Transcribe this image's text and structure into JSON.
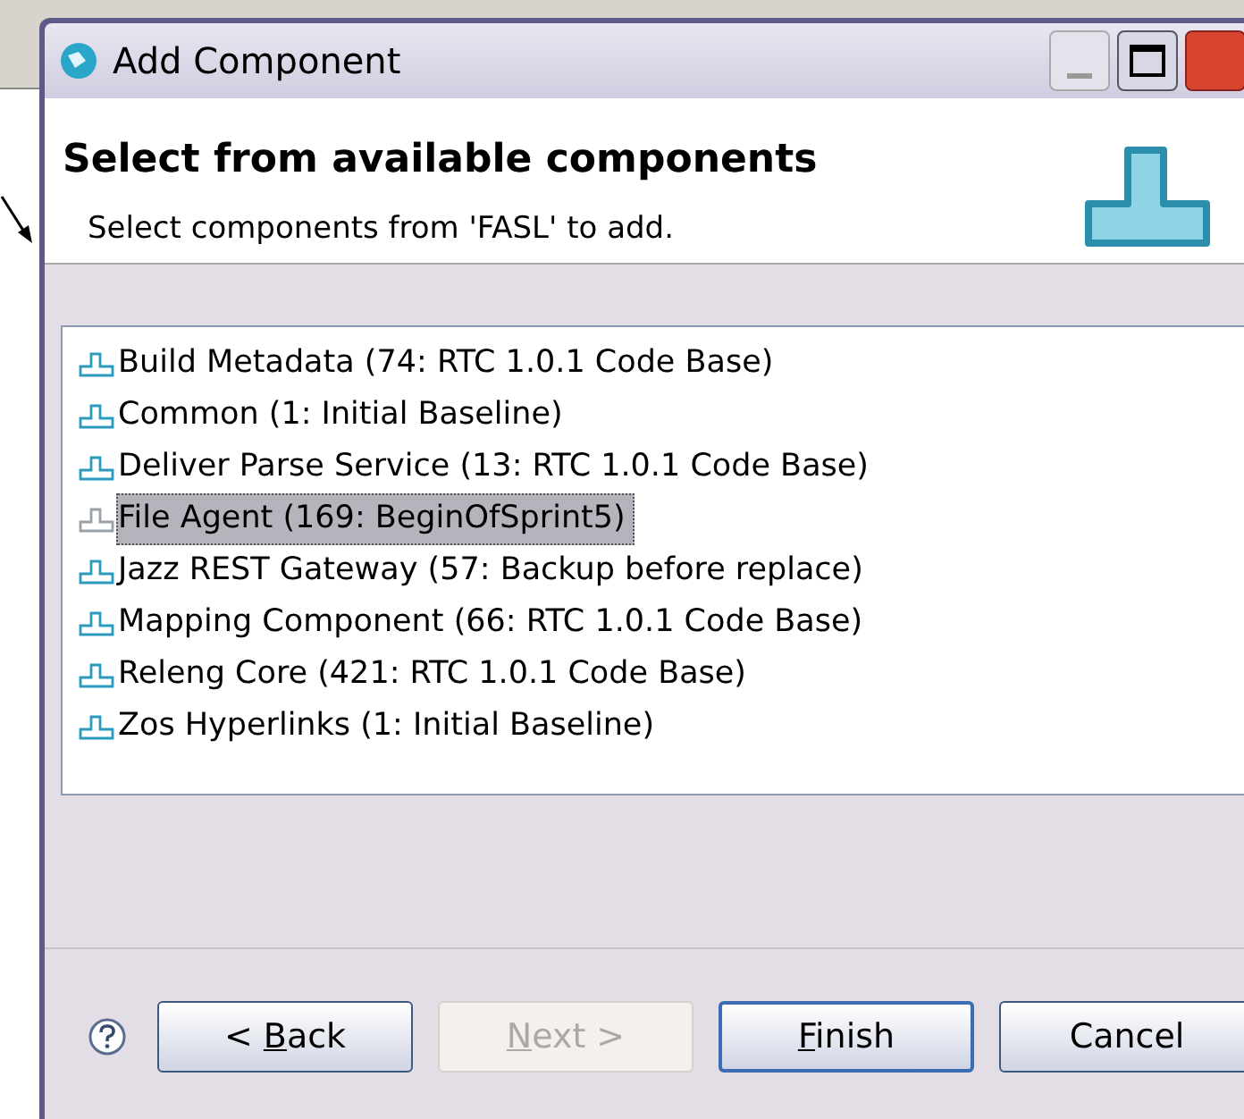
{
  "window": {
    "title": "Add Component"
  },
  "header": {
    "title": "Select from available components",
    "subtitle": "Select components from 'FASL' to add."
  },
  "components": [
    {
      "label": "Build Metadata (74: RTC 1.0.1 Code Base)",
      "selected": false
    },
    {
      "label": "Common (1: Initial Baseline)",
      "selected": false
    },
    {
      "label": "Deliver Parse Service (13: RTC 1.0.1 Code Base)",
      "selected": false
    },
    {
      "label": "File Agent (169: BeginOfSprint5)",
      "selected": true
    },
    {
      "label": "Jazz REST Gateway (57: Backup before replace)",
      "selected": false
    },
    {
      "label": "Mapping Component (66: RTC 1.0.1 Code Base)",
      "selected": false
    },
    {
      "label": "Releng Core (421: RTC 1.0.1 Code Base)",
      "selected": false
    },
    {
      "label": "Zos Hyperlinks (1: Initial Baseline)",
      "selected": false
    }
  ],
  "buttons": [
    {
      "before": "< ",
      "key": "B",
      "after": "ack",
      "disabled": false,
      "default": false
    },
    {
      "key": "N",
      "after": "ext >",
      "disabled": true,
      "default": false
    },
    {
      "key": "F",
      "after": "inish",
      "disabled": false,
      "default": true
    },
    {
      "after": "Cancel",
      "disabled": false,
      "default": false
    }
  ]
}
